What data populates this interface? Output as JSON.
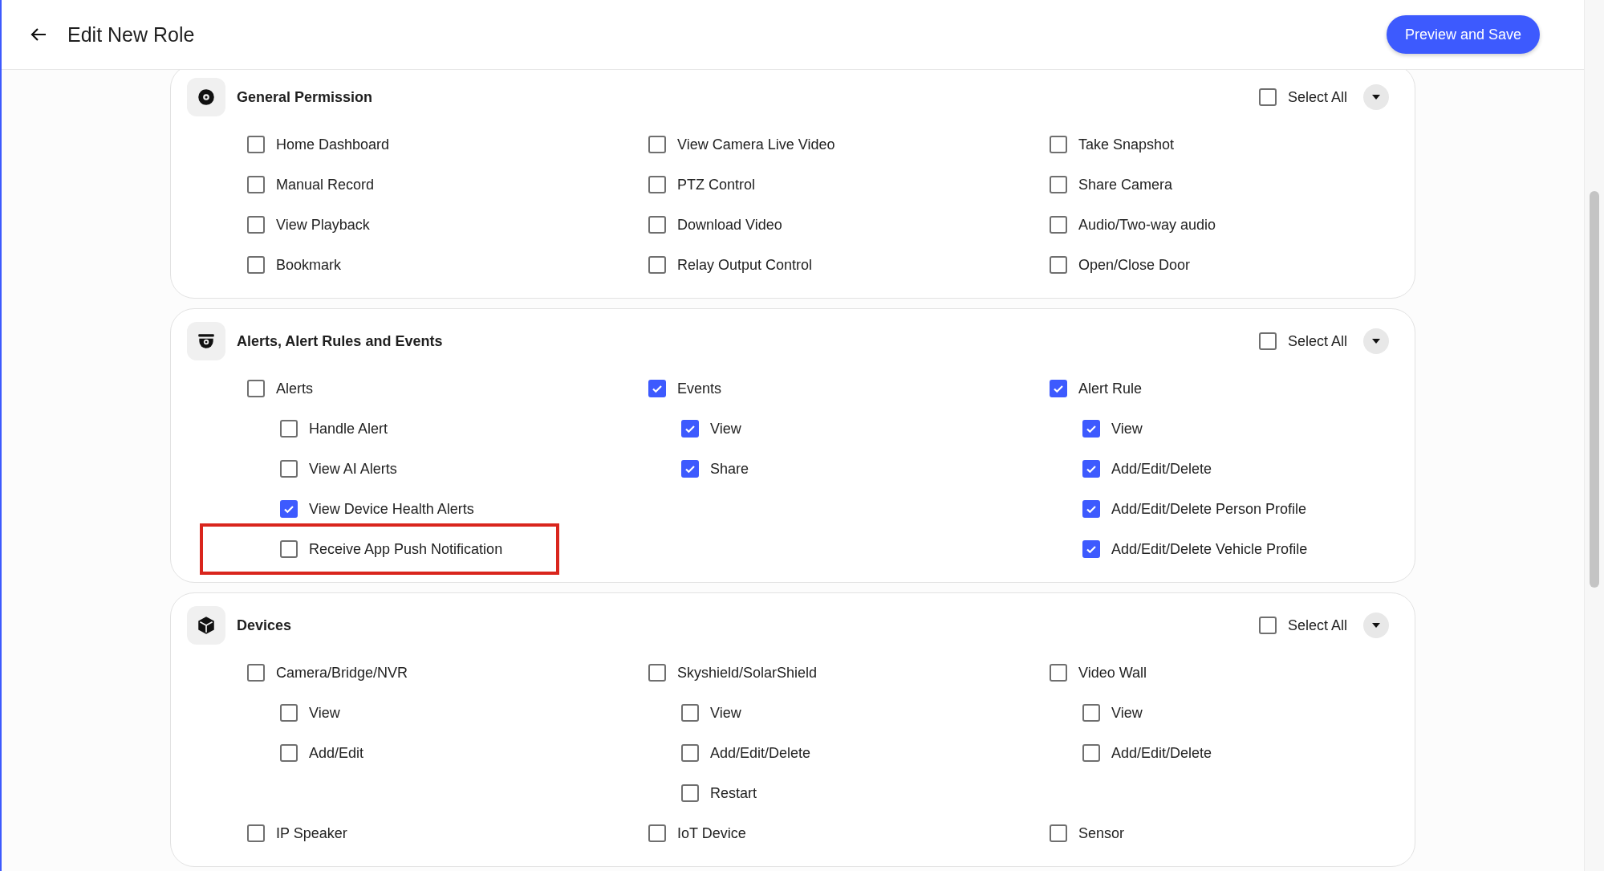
{
  "header": {
    "title": "Edit New Role",
    "button": "Preview and Save"
  },
  "sections": [
    {
      "title": "General Permission",
      "select_all": {
        "label": "Select All",
        "checked": false
      },
      "items": [
        {
          "label": "Home Dashboard",
          "checked": false
        },
        {
          "label": "View Camera Live Video",
          "checked": false
        },
        {
          "label": "Take Snapshot",
          "checked": false
        },
        {
          "label": "Manual Record",
          "checked": false
        },
        {
          "label": "PTZ Control",
          "checked": false
        },
        {
          "label": "Share Camera",
          "checked": false
        },
        {
          "label": "View Playback",
          "checked": false
        },
        {
          "label": "Download Video",
          "checked": false
        },
        {
          "label": "Audio/Two-way audio",
          "checked": false
        },
        {
          "label": "Bookmark",
          "checked": false
        },
        {
          "label": "Relay Output Control",
          "checked": false
        },
        {
          "label": "Open/Close Door",
          "checked": false
        }
      ]
    },
    {
      "title": "Alerts, Alert Rules and Events",
      "select_all": {
        "label": "Select All",
        "checked": false
      },
      "items": [
        {
          "label": "Alerts",
          "checked": false,
          "children": [
            {
              "label": "Handle Alert",
              "checked": false
            },
            {
              "label": "View AI Alerts",
              "checked": false
            },
            {
              "label": "View Device Health Alerts",
              "checked": true
            },
            {
              "label": "Receive App Push Notification",
              "checked": false,
              "highlighted": true
            }
          ]
        },
        {
          "label": "Events",
          "checked": true,
          "children": [
            {
              "label": "View",
              "checked": true
            },
            {
              "label": "Share",
              "checked": true
            }
          ]
        },
        {
          "label": "Alert Rule",
          "checked": true,
          "children": [
            {
              "label": "View",
              "checked": true
            },
            {
              "label": "Add/Edit/Delete",
              "checked": true
            },
            {
              "label": "Add/Edit/Delete Person Profile",
              "checked": true
            },
            {
              "label": "Add/Edit/Delete Vehicle Profile",
              "checked": true
            }
          ]
        }
      ]
    },
    {
      "title": "Devices",
      "select_all": {
        "label": "Select All",
        "checked": false
      },
      "items": [
        {
          "label": "Camera/Bridge/NVR",
          "checked": false,
          "children": [
            {
              "label": "View",
              "checked": false
            },
            {
              "label": "Add/Edit",
              "checked": false
            }
          ]
        },
        {
          "label": "Skyshield/SolarShield",
          "checked": false,
          "children": [
            {
              "label": "View",
              "checked": false
            },
            {
              "label": "Add/Edit/Delete",
              "checked": false
            },
            {
              "label": "Restart",
              "checked": false
            }
          ]
        },
        {
          "label": "Video Wall",
          "checked": false,
          "children": [
            {
              "label": "View",
              "checked": false
            },
            {
              "label": "Add/Edit/Delete",
              "checked": false
            }
          ]
        },
        {
          "label": "IP Speaker",
          "checked": false
        },
        {
          "label": "IoT Device",
          "checked": false
        },
        {
          "label": "Sensor",
          "checked": false
        }
      ]
    }
  ]
}
